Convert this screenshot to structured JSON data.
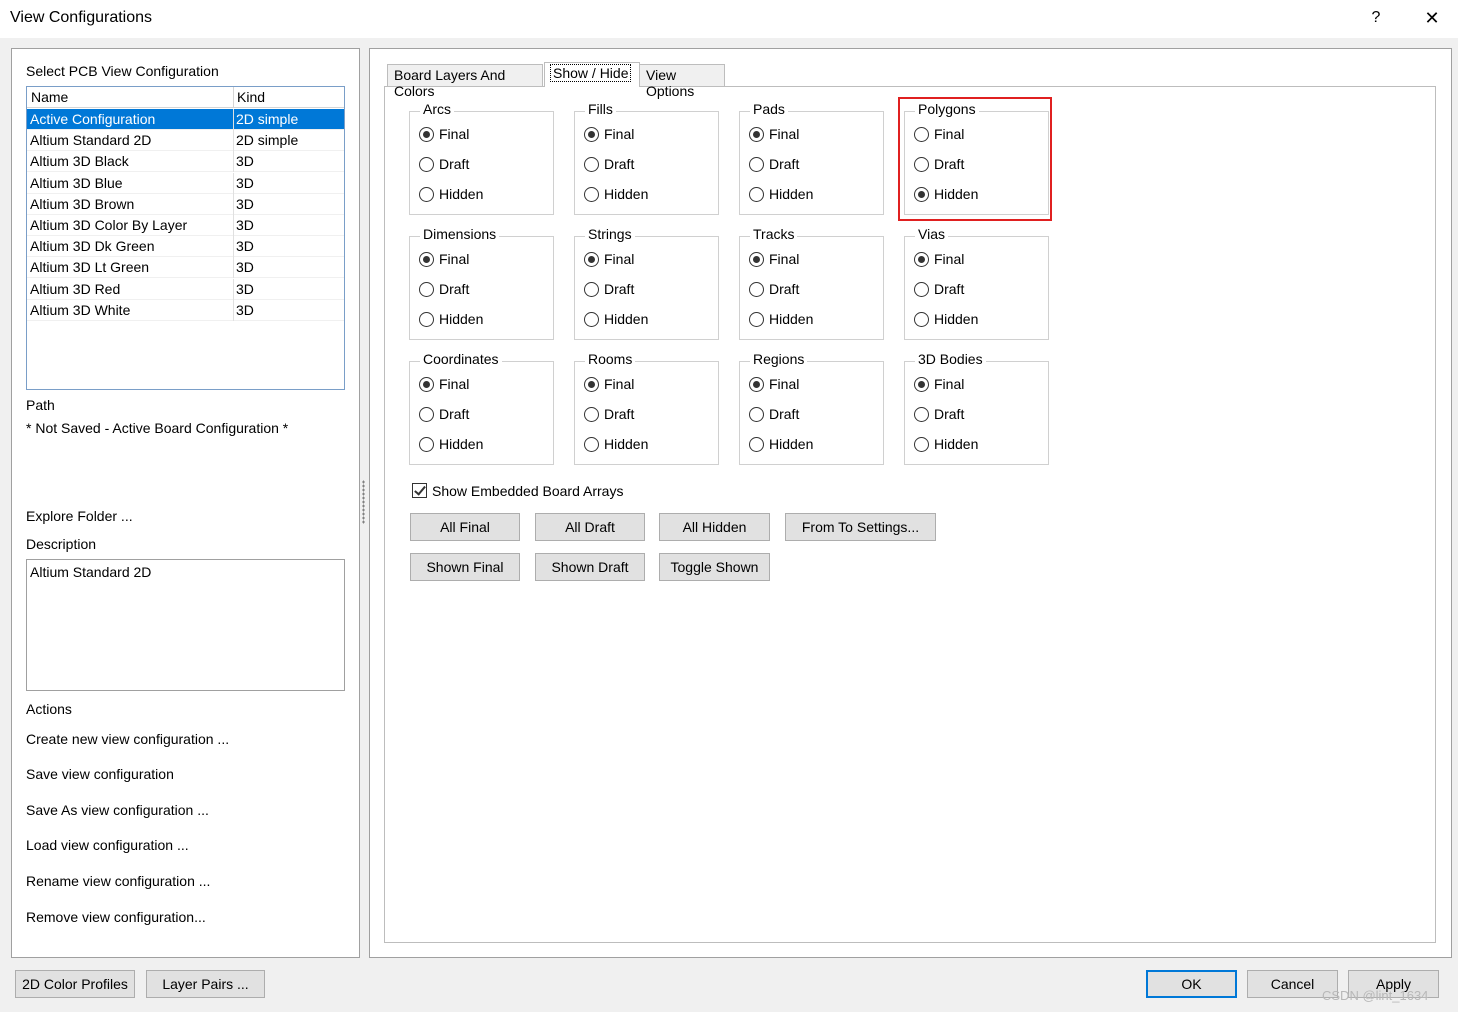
{
  "window": {
    "title": "View Configurations",
    "help_label": "?",
    "close_label": "✕"
  },
  "left": {
    "select_label": "Select PCB View Configuration",
    "list": {
      "columns": [
        "Name",
        "Kind"
      ],
      "rows": [
        {
          "name": "Active Configuration",
          "kind": "2D simple"
        },
        {
          "name": "Altium Standard 2D",
          "kind": "2D simple"
        },
        {
          "name": "Altium 3D Black",
          "kind": "3D"
        },
        {
          "name": "Altium 3D Blue",
          "kind": "3D"
        },
        {
          "name": "Altium 3D Brown",
          "kind": "3D"
        },
        {
          "name": "Altium 3D Color By Layer",
          "kind": "3D"
        },
        {
          "name": "Altium 3D Dk Green",
          "kind": "3D"
        },
        {
          "name": "Altium 3D Lt Green",
          "kind": "3D"
        },
        {
          "name": "Altium 3D Red",
          "kind": "3D"
        },
        {
          "name": "Altium 3D White",
          "kind": "3D"
        }
      ]
    },
    "path_label": "Path",
    "path_value": "* Not Saved - Active Board Configuration *",
    "explore_folder": "Explore Folder ...",
    "description_label": "Description",
    "description_value": "Altium Standard 2D",
    "actions_label": "Actions",
    "actions": [
      "Create new view configuration ...",
      "Save view configuration",
      "Save As view configuration ...",
      "Load view configuration ...",
      "Rename view configuration ...",
      "Remove view configuration..."
    ]
  },
  "tabs": [
    "Board Layers And Colors",
    "Show / Hide",
    "View Options"
  ],
  "radio_labels": [
    "Final",
    "Draft",
    "Hidden"
  ],
  "groups": [
    {
      "name": "Arcs",
      "selected": "Final"
    },
    {
      "name": "Fills",
      "selected": "Final"
    },
    {
      "name": "Pads",
      "selected": "Final"
    },
    {
      "name": "Polygons",
      "selected": "Hidden"
    },
    {
      "name": "Dimensions",
      "selected": "Final"
    },
    {
      "name": "Strings",
      "selected": "Final"
    },
    {
      "name": "Tracks",
      "selected": "Final"
    },
    {
      "name": "Vias",
      "selected": "Final"
    },
    {
      "name": "Coordinates",
      "selected": "Final"
    },
    {
      "name": "Rooms",
      "selected": "Final"
    },
    {
      "name": "Regions",
      "selected": "Final"
    },
    {
      "name": "3D Bodies",
      "selected": "Final"
    }
  ],
  "embedded_arrays": {
    "label": "Show Embedded Board Arrays",
    "checked": true
  },
  "buttons_row1": [
    "All Final",
    "All Draft",
    "All Hidden",
    "From To Settings..."
  ],
  "buttons_row2": [
    "Shown Final",
    "Shown Draft",
    "Toggle Shown"
  ],
  "footer": {
    "color_profiles": "2D Color Profiles",
    "layer_pairs": "Layer Pairs ...",
    "ok": "OK",
    "cancel": "Cancel",
    "apply": "Apply"
  },
  "watermark": "CSDN @lint_1634",
  "colors": {
    "selection": "#0078d7",
    "highlight_box": "#e02020"
  }
}
